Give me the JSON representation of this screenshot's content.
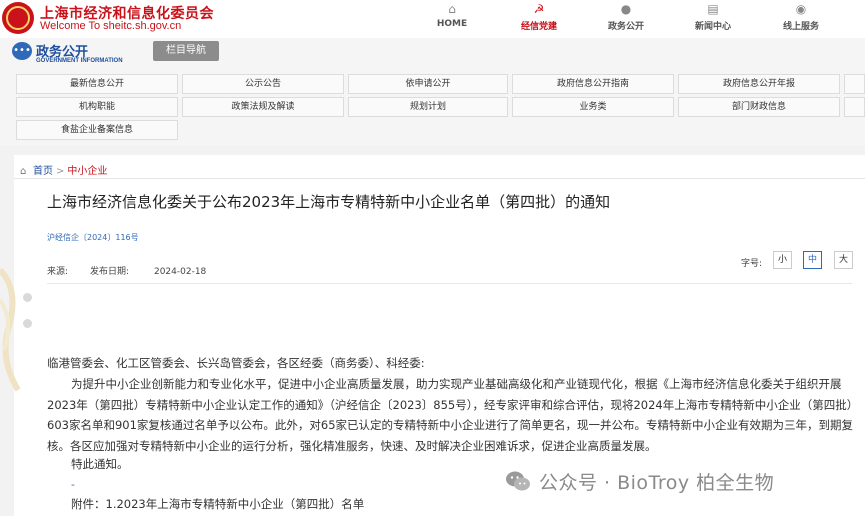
{
  "header": {
    "site_name_cn": "上海市经济和信息化委员会",
    "site_name_en": "Welcome To sheitc.sh.gov.cn",
    "nav": [
      {
        "label": "HOME",
        "icon": "home-icon"
      },
      {
        "label": "经信党建",
        "icon": "party-emblem-icon"
      },
      {
        "label": "政务公开",
        "icon": "chat-icon"
      },
      {
        "label": "新闻中心",
        "icon": "news-icon"
      },
      {
        "label": "线上服务",
        "icon": "service-icon"
      }
    ]
  },
  "section": {
    "title": "政务公开",
    "subtitle": "GOVERNMENT INFORMATION",
    "column_nav": "栏目导航"
  },
  "menu": [
    "最新信息公开",
    "公示公告",
    "依申请公开",
    "政府信息公开指南",
    "政府信息公开年报",
    "机构职能",
    "政策法规及解读",
    "规划计划",
    "业务类",
    "部门财政信息",
    "食盐企业备案信息"
  ],
  "breadcrumb": {
    "home": "首页",
    "separator": ">",
    "current": "中小企业"
  },
  "article": {
    "title": "上海市经济信息化委关于公布2023年上海市专精特新中小企业名单（第四批）的通知",
    "doc_no": "沪经信企〔2024〕116号",
    "source_label": "来源:",
    "date_label": "发布日期:",
    "date": "2024-02-18",
    "font_size_label": "字号:",
    "font_sizes": [
      "小",
      "中",
      "大"
    ],
    "recipient": "临港管委会、化工区管委会、长兴岛管委会，各区经委（商务委）、科经委:",
    "main_paragraph": "为提升中小企业创新能力和专业化水平，促进中小企业高质量发展，助力实现产业基础高级化和产业链现代化，根据《上海市经济信息化委关于组织开展2023年（第四批）专精特新中小企业认定工作的通知》（沪经信企〔2023〕855号），经专家评审和综合评估，现将2024年上海市专精特新中小企业（第四批）603家名单和901家复核通过名单予以公布。此外，对65家已认定的专精特新中小企业进行了简单更名，现一并公布。专精特新中小企业有效期为三年，到期复核。各区应加强对专精特新中小企业的运行分析，强化精准服务，快速、及时解决企业困难诉求，促进企业高质量发展。",
    "notice": "特此通知。",
    "dash": "-",
    "attachment": "附件：1.2023年上海市专精特新中小企业（第四批）名单"
  },
  "watermark": {
    "text": "公众号 · BioTroy 柏全生物",
    "icon": "wechat-icon"
  }
}
